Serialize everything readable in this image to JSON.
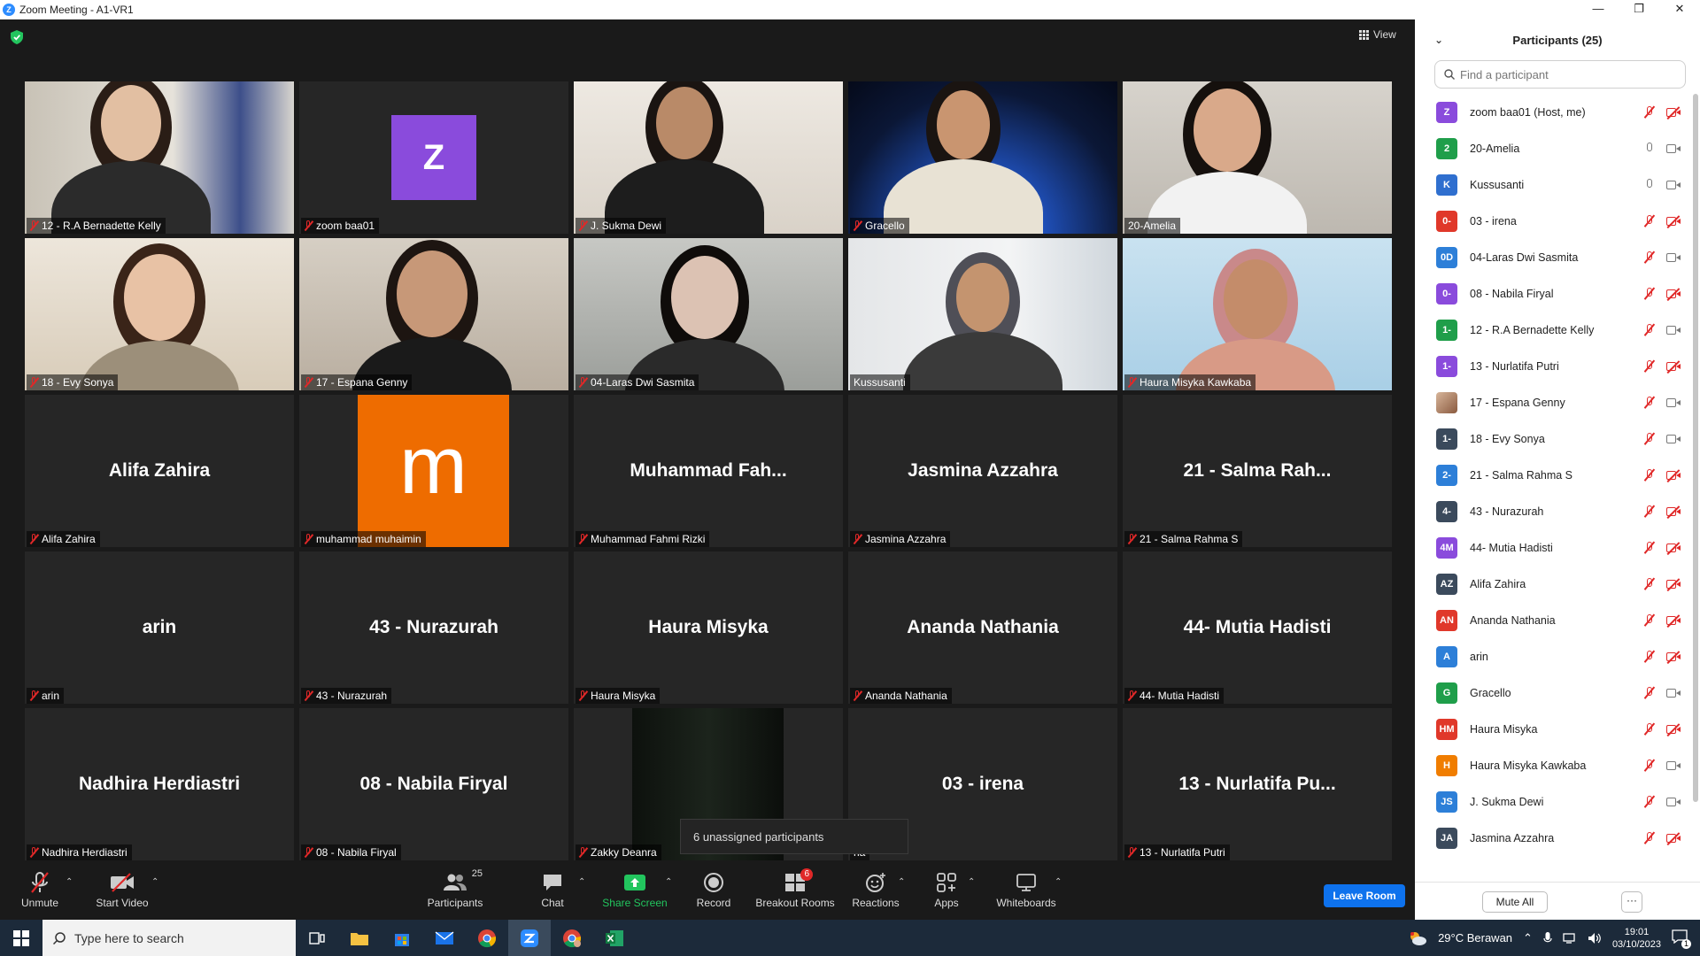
{
  "window": {
    "title": "Zoom Meeting - A1-VR1",
    "logo_letter": "Z",
    "controls": [
      "—",
      "❐",
      "✕"
    ]
  },
  "view": {
    "label": "View"
  },
  "tiles": [
    {
      "name": "12 - R.A Bernadette Kelly",
      "display": "",
      "muted": true
    },
    {
      "name": "zoom baa01",
      "display": "",
      "muted": true,
      "avatar_letter": "Z"
    },
    {
      "name": "J. Sukma Dewi",
      "display": "",
      "muted": true
    },
    {
      "name": "Gracello",
      "display": "",
      "muted": true
    },
    {
      "name": "20-Amelia",
      "display": "",
      "muted": false,
      "active": true
    },
    {
      "name": "18 - Evy Sonya",
      "display": "",
      "muted": true
    },
    {
      "name": "17 - Espana Genny",
      "display": "",
      "muted": true
    },
    {
      "name": "04-Laras Dwi Sasmita",
      "display": "",
      "muted": true
    },
    {
      "name": "Kussusanti",
      "display": "",
      "muted": false
    },
    {
      "name": "Haura Misyka Kawkaba",
      "display": "",
      "muted": true
    },
    {
      "name": "Alifa Zahira",
      "display": "Alifa Zahira",
      "muted": true
    },
    {
      "name": "muhammad muhaimin",
      "display": "",
      "muted": true,
      "avatar_letter": "m"
    },
    {
      "name": "Muhammad Fahmi Rizki",
      "display": "Muhammad  Fah...",
      "muted": true
    },
    {
      "name": "Jasmina Azzahra",
      "display": "Jasmina Azzahra",
      "muted": true
    },
    {
      "name": "21 - Salma Rahma S",
      "display": "21 - Salma Rah...",
      "muted": true
    },
    {
      "name": "arin",
      "display": "arin",
      "muted": true
    },
    {
      "name": "43 - Nurazurah",
      "display": "43 - Nurazurah",
      "muted": true
    },
    {
      "name": "Haura Misyka",
      "display": "Haura Misyka",
      "muted": true
    },
    {
      "name": "Ananda Nathania",
      "display": "Ananda Nathania",
      "muted": true
    },
    {
      "name": "44- Mutia Hadisti",
      "display": "44- Mutia Hadisti",
      "muted": true
    },
    {
      "name": "Nadhira Herdiastri",
      "display": "Nadhira Herdiastri",
      "muted": true
    },
    {
      "name": "08 - Nabila Firyal",
      "display": "08 - Nabila Firyal",
      "muted": true
    },
    {
      "name": "Zakky Deanra",
      "display": "",
      "muted": true
    },
    {
      "name": "na",
      "display": "03 - irena",
      "muted": false
    },
    {
      "name": "13 - Nurlatifa Putri",
      "display": "13 - Nurlatifa Pu...",
      "muted": true
    }
  ],
  "tooltip": "6 unassigned participants",
  "toolbar": {
    "unmute": "Unmute",
    "start_video": "Start Video",
    "participants": "Participants",
    "participants_count": "25",
    "chat": "Chat",
    "share_screen": "Share Screen",
    "record": "Record",
    "breakout_rooms": "Breakout Rooms",
    "breakout_badge": "6",
    "reactions": "Reactions",
    "apps": "Apps",
    "whiteboards": "Whiteboards",
    "leave": "Leave Room",
    "caret": "⌃"
  },
  "panel": {
    "title": "Participants (25)",
    "collapse": "⌄",
    "search_placeholder": "Find a participant",
    "mute_all": "Mute All",
    "more": "···",
    "participants": [
      {
        "initials": "Z",
        "name": "zoom baa01 (Host, me)",
        "color": "#8a4bdc",
        "mic": "off",
        "cam": "off"
      },
      {
        "initials": "2",
        "name": "20-Amelia",
        "color": "#1f9e4a",
        "mic": "on",
        "cam": "on"
      },
      {
        "initials": "K",
        "name": "Kussusanti",
        "color": "#2f6fcf",
        "mic": "on",
        "cam": "on"
      },
      {
        "initials": "0-",
        "name": "03 - irena",
        "color": "#e0382a",
        "mic": "off",
        "cam": "off"
      },
      {
        "initials": "0D",
        "name": "04-Laras Dwi Sasmita",
        "color": "#2d7fd8",
        "mic": "off",
        "cam": "on"
      },
      {
        "initials": "0-",
        "name": "08 - Nabila Firyal",
        "color": "#8a4bdc",
        "mic": "off",
        "cam": "off"
      },
      {
        "initials": "1-",
        "name": "12 - R.A Bernadette Kelly",
        "color": "#1f9e4a",
        "mic": "off",
        "cam": "on"
      },
      {
        "initials": "1-",
        "name": "13 - Nurlatifa Putri",
        "color": "#8a4bdc",
        "mic": "off",
        "cam": "off"
      },
      {
        "initials": "",
        "name": "17 - Espana Genny",
        "color": "photo",
        "mic": "off",
        "cam": "on"
      },
      {
        "initials": "1-",
        "name": "18 - Evy Sonya",
        "color": "#3b4a5c",
        "mic": "off",
        "cam": "on"
      },
      {
        "initials": "2-",
        "name": "21 - Salma Rahma S",
        "color": "#2d7fd8",
        "mic": "off",
        "cam": "off"
      },
      {
        "initials": "4-",
        "name": "43 - Nurazurah",
        "color": "#3b4a5c",
        "mic": "off",
        "cam": "off"
      },
      {
        "initials": "4M",
        "name": "44- Mutia Hadisti",
        "color": "#8a4bdc",
        "mic": "off",
        "cam": "off"
      },
      {
        "initials": "AZ",
        "name": "Alifa Zahira",
        "color": "#3b4a5c",
        "mic": "off",
        "cam": "off"
      },
      {
        "initials": "AN",
        "name": "Ananda Nathania",
        "color": "#e0382a",
        "mic": "off",
        "cam": "off"
      },
      {
        "initials": "A",
        "name": "arin",
        "color": "#2d7fd8",
        "mic": "off",
        "cam": "off"
      },
      {
        "initials": "G",
        "name": "Gracello",
        "color": "#1f9e4a",
        "mic": "off",
        "cam": "on"
      },
      {
        "initials": "HM",
        "name": "Haura Misyka",
        "color": "#e0382a",
        "mic": "off",
        "cam": "off"
      },
      {
        "initials": "H",
        "name": "Haura Misyka Kawkaba",
        "color": "#f07d00",
        "mic": "off",
        "cam": "on"
      },
      {
        "initials": "JS",
        "name": "J. Sukma Dewi",
        "color": "#2d7fd8",
        "mic": "off",
        "cam": "on"
      },
      {
        "initials": "JA",
        "name": "Jasmina Azzahra",
        "color": "#3b4a5c",
        "mic": "off",
        "cam": "off"
      }
    ]
  },
  "taskbar": {
    "search_placeholder": "Type here to search",
    "weather": "29°C  Berawan",
    "time": "19:01",
    "date": "03/10/2023",
    "notif": "1"
  }
}
